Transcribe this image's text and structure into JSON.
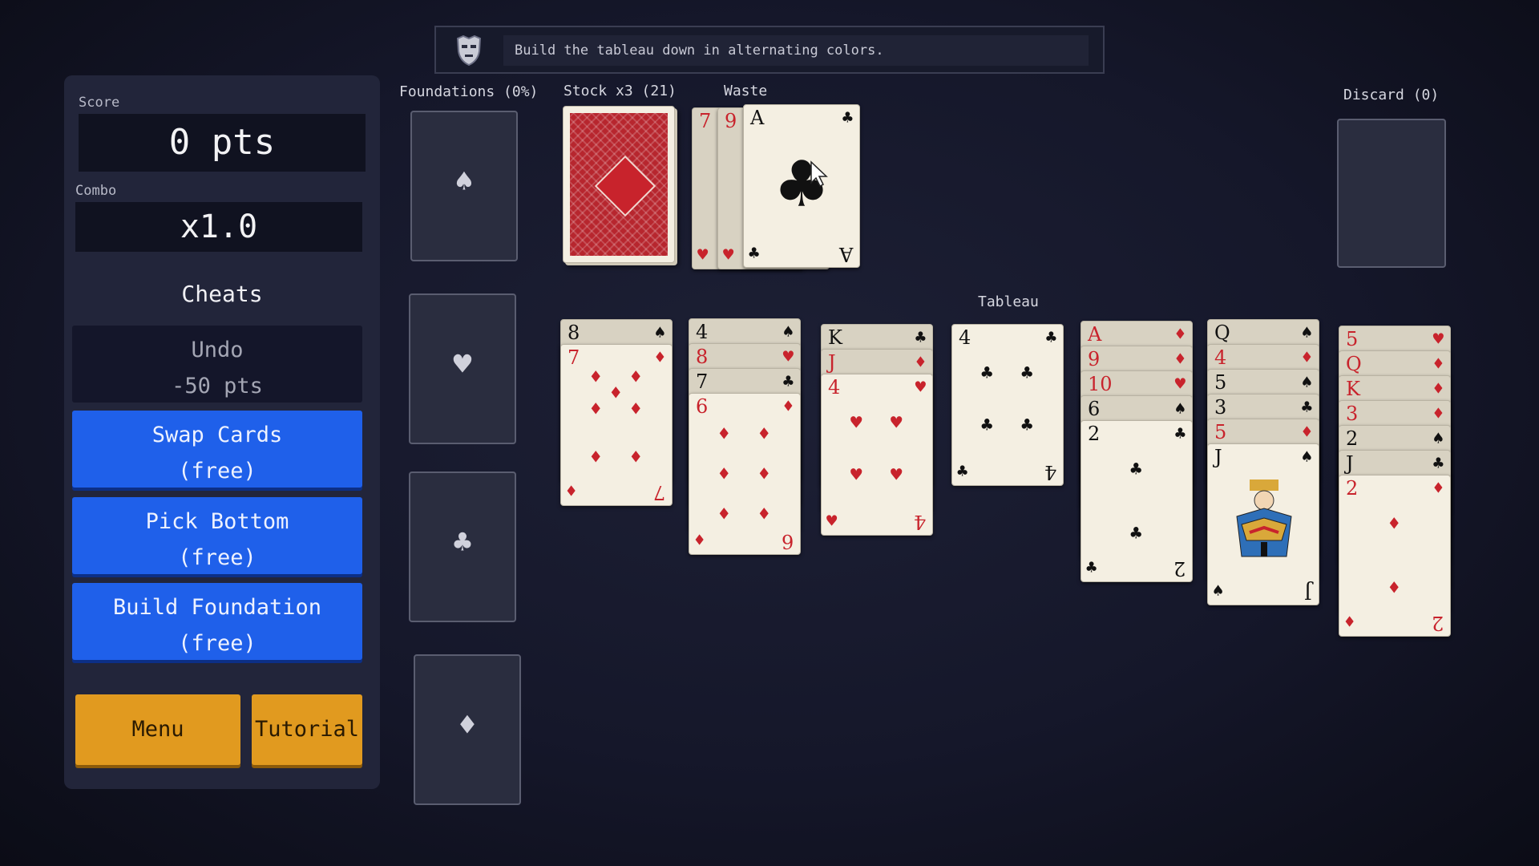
{
  "hint": {
    "text": "Build the tableau down in alternating colors."
  },
  "sidebar": {
    "score_label": "Score",
    "score_value": "0 pts",
    "combo_label": "Combo",
    "combo_value": "x1.0",
    "cheats_title": "Cheats",
    "cheats": [
      {
        "label": "Undo",
        "cost": "-50 pts"
      },
      {
        "label": "Swap Cards",
        "cost": "(free)"
      },
      {
        "label": "Pick Bottom",
        "cost": "(free)"
      },
      {
        "label": "Build Foundation",
        "cost": "(free)"
      }
    ],
    "menu_label": "Menu",
    "tutorial_label": "Tutorial"
  },
  "labels": {
    "foundations": "Foundations (0%)",
    "stock": "Stock x3 (21)",
    "waste": "Waste",
    "discard": "Discard (0)",
    "tableau": "Tableau"
  },
  "foundation_suits": [
    "♠",
    "♥",
    "♣",
    "♦"
  ],
  "waste": {
    "under": [
      {
        "rank": "7",
        "suit": "♥"
      },
      {
        "rank": "9",
        "suit": "♥"
      }
    ],
    "top": {
      "rank": "A",
      "suit": "♣",
      "rank_flipped": "A"
    }
  },
  "tableau": [
    {
      "cards": [
        {
          "rank": "8",
          "suit": "♠"
        },
        {
          "rank": "7",
          "suit": "♦"
        }
      ]
    },
    {
      "cards": [
        {
          "rank": "4",
          "suit": "♠"
        },
        {
          "rank": "8",
          "suit": "♥"
        },
        {
          "rank": "7",
          "suit": "♣"
        },
        {
          "rank": "6",
          "suit": "♦"
        }
      ]
    },
    {
      "cards": [
        {
          "rank": "K",
          "suit": "♣"
        },
        {
          "rank": "J",
          "suit": "♦"
        },
        {
          "rank": "4",
          "suit": "♥"
        }
      ]
    },
    {
      "cards": [
        {
          "rank": "4",
          "suit": "♣"
        }
      ]
    },
    {
      "cards": [
        {
          "rank": "A",
          "suit": "♦"
        },
        {
          "rank": "9",
          "suit": "♦"
        },
        {
          "rank": "10",
          "suit": "♥"
        },
        {
          "rank": "6",
          "suit": "♠"
        },
        {
          "rank": "2",
          "suit": "♣"
        }
      ]
    },
    {
      "cards": [
        {
          "rank": "Q",
          "suit": "♠"
        },
        {
          "rank": "4",
          "suit": "♦"
        },
        {
          "rank": "5",
          "suit": "♠"
        },
        {
          "rank": "3",
          "suit": "♣"
        },
        {
          "rank": "5",
          "suit": "♦"
        },
        {
          "rank": "J",
          "suit": "♠"
        }
      ]
    },
    {
      "cards": [
        {
          "rank": "5",
          "suit": "♥"
        },
        {
          "rank": "Q",
          "suit": "♦"
        },
        {
          "rank": "K",
          "suit": "♦"
        },
        {
          "rank": "3",
          "suit": "♦"
        },
        {
          "rank": "2",
          "suit": "♠"
        },
        {
          "rank": "J",
          "suit": "♣"
        },
        {
          "rank": "2",
          "suit": "♦"
        }
      ]
    }
  ],
  "colors": {
    "red": "#c8232c",
    "black": "#111111",
    "accent_blue": "#1f60ea",
    "accent_orange": "#e19a1f"
  }
}
